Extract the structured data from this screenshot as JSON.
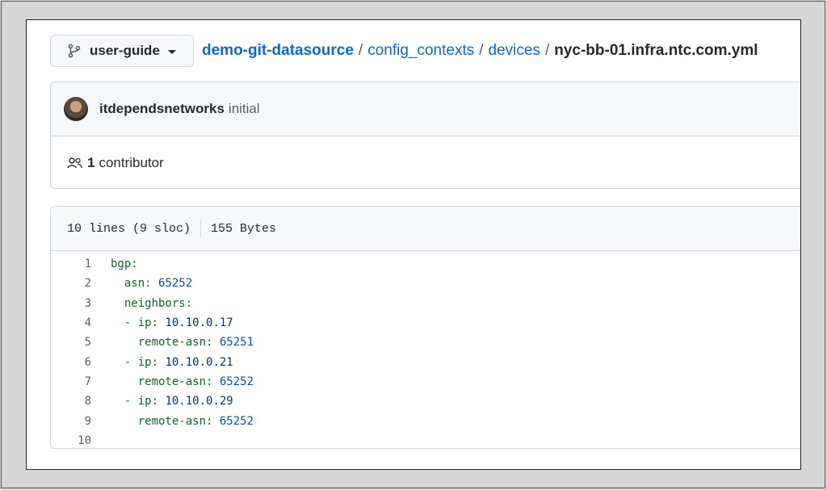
{
  "branch": {
    "name": "user-guide"
  },
  "breadcrumb": {
    "repo": "demo-git-datasource",
    "dir1": "config_contexts",
    "dir2": "devices",
    "file": "nyc-bb-01.infra.ntc.com.yml",
    "separator": "/"
  },
  "commit": {
    "author": "itdependsnetworks",
    "message": "initial",
    "contributors_count": "1",
    "contributors_label": "contributor"
  },
  "file_info": {
    "lines": "10 lines (9 sloc)",
    "size": "155 Bytes"
  },
  "code": [
    {
      "num": "1",
      "indent": "",
      "key": "bgp",
      "colon": ":",
      "value": "",
      "value_type": ""
    },
    {
      "num": "2",
      "indent": "  ",
      "key": "asn",
      "colon": ": ",
      "value": "65252",
      "value_type": "n"
    },
    {
      "num": "3",
      "indent": "  ",
      "key": "neighbors",
      "colon": ":",
      "value": "",
      "value_type": ""
    },
    {
      "num": "4",
      "indent": "  - ",
      "key": "ip",
      "colon": ": ",
      "value": "10.10.0.17",
      "value_type": "v"
    },
    {
      "num": "5",
      "indent": "    ",
      "key": "remote-asn",
      "colon": ": ",
      "value": "65251",
      "value_type": "n"
    },
    {
      "num": "6",
      "indent": "  - ",
      "key": "ip",
      "colon": ": ",
      "value": "10.10.0.21",
      "value_type": "v"
    },
    {
      "num": "7",
      "indent": "    ",
      "key": "remote-asn",
      "colon": ": ",
      "value": "65252",
      "value_type": "n"
    },
    {
      "num": "8",
      "indent": "  - ",
      "key": "ip",
      "colon": ": ",
      "value": "10.10.0.29",
      "value_type": "v"
    },
    {
      "num": "9",
      "indent": "    ",
      "key": "remote-asn",
      "colon": ": ",
      "value": "65252",
      "value_type": "n"
    },
    {
      "num": "10",
      "indent": "",
      "key": "",
      "colon": "",
      "value": "",
      "value_type": ""
    }
  ]
}
